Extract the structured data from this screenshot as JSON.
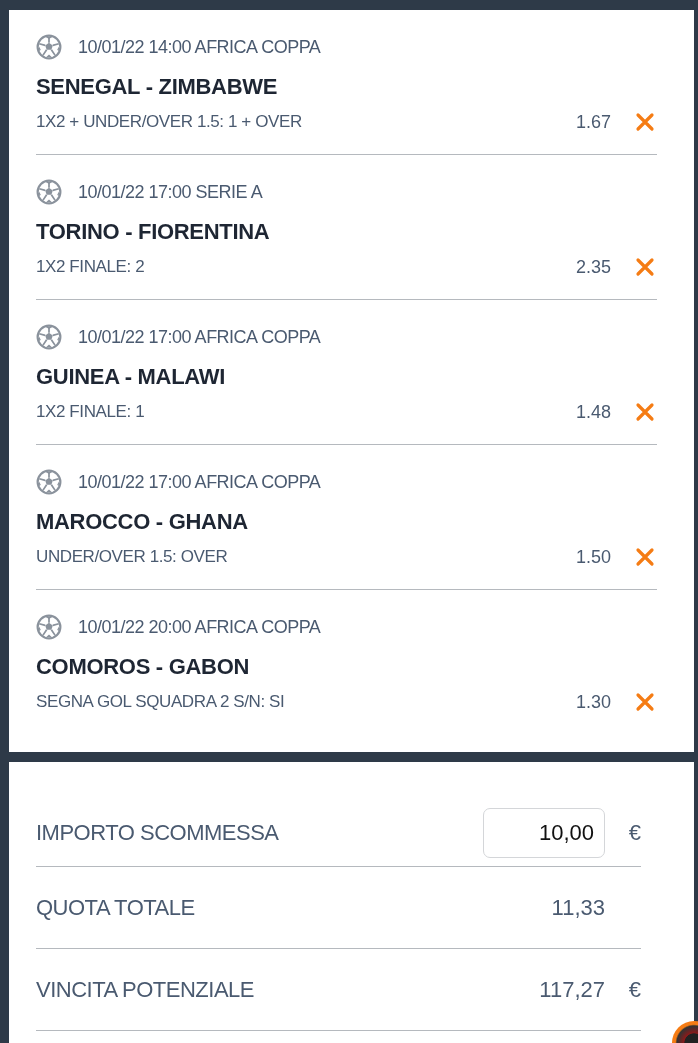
{
  "bets": [
    {
      "event": "10/01/22 14:00 AFRICA COPPA",
      "match": "SENEGAL - ZIMBABWE",
      "market": "1X2 + UNDER/OVER 1.5: 1 + OVER",
      "odds": "1.67"
    },
    {
      "event": "10/01/22 17:00 SERIE A",
      "match": "TORINO - FIORENTINA",
      "market": "1X2 FINALE: 2",
      "odds": "2.35"
    },
    {
      "event": "10/01/22 17:00 AFRICA COPPA",
      "match": "GUINEA - MALAWI",
      "market": "1X2 FINALE: 1",
      "odds": "1.48"
    },
    {
      "event": "10/01/22 17:00 AFRICA COPPA",
      "match": "MAROCCO - GHANA",
      "market": "UNDER/OVER 1.5: OVER",
      "odds": "1.50"
    },
    {
      "event": "10/01/22 20:00 AFRICA COPPA",
      "match": "COMOROS - GABON",
      "market": "SEGNA GOL SQUADRA 2 S/N: SI",
      "odds": "1.30"
    }
  ],
  "summary": [
    {
      "kind": "input",
      "label": "IMPORTO SCOMMESSA",
      "value": "10,00",
      "currency": "€"
    },
    {
      "kind": "text",
      "label": "QUOTA TOTALE",
      "value": "11,33"
    },
    {
      "kind": "text",
      "label": "VINCITA POTENZIALE",
      "value": "117,27",
      "currency": "€"
    }
  ]
}
